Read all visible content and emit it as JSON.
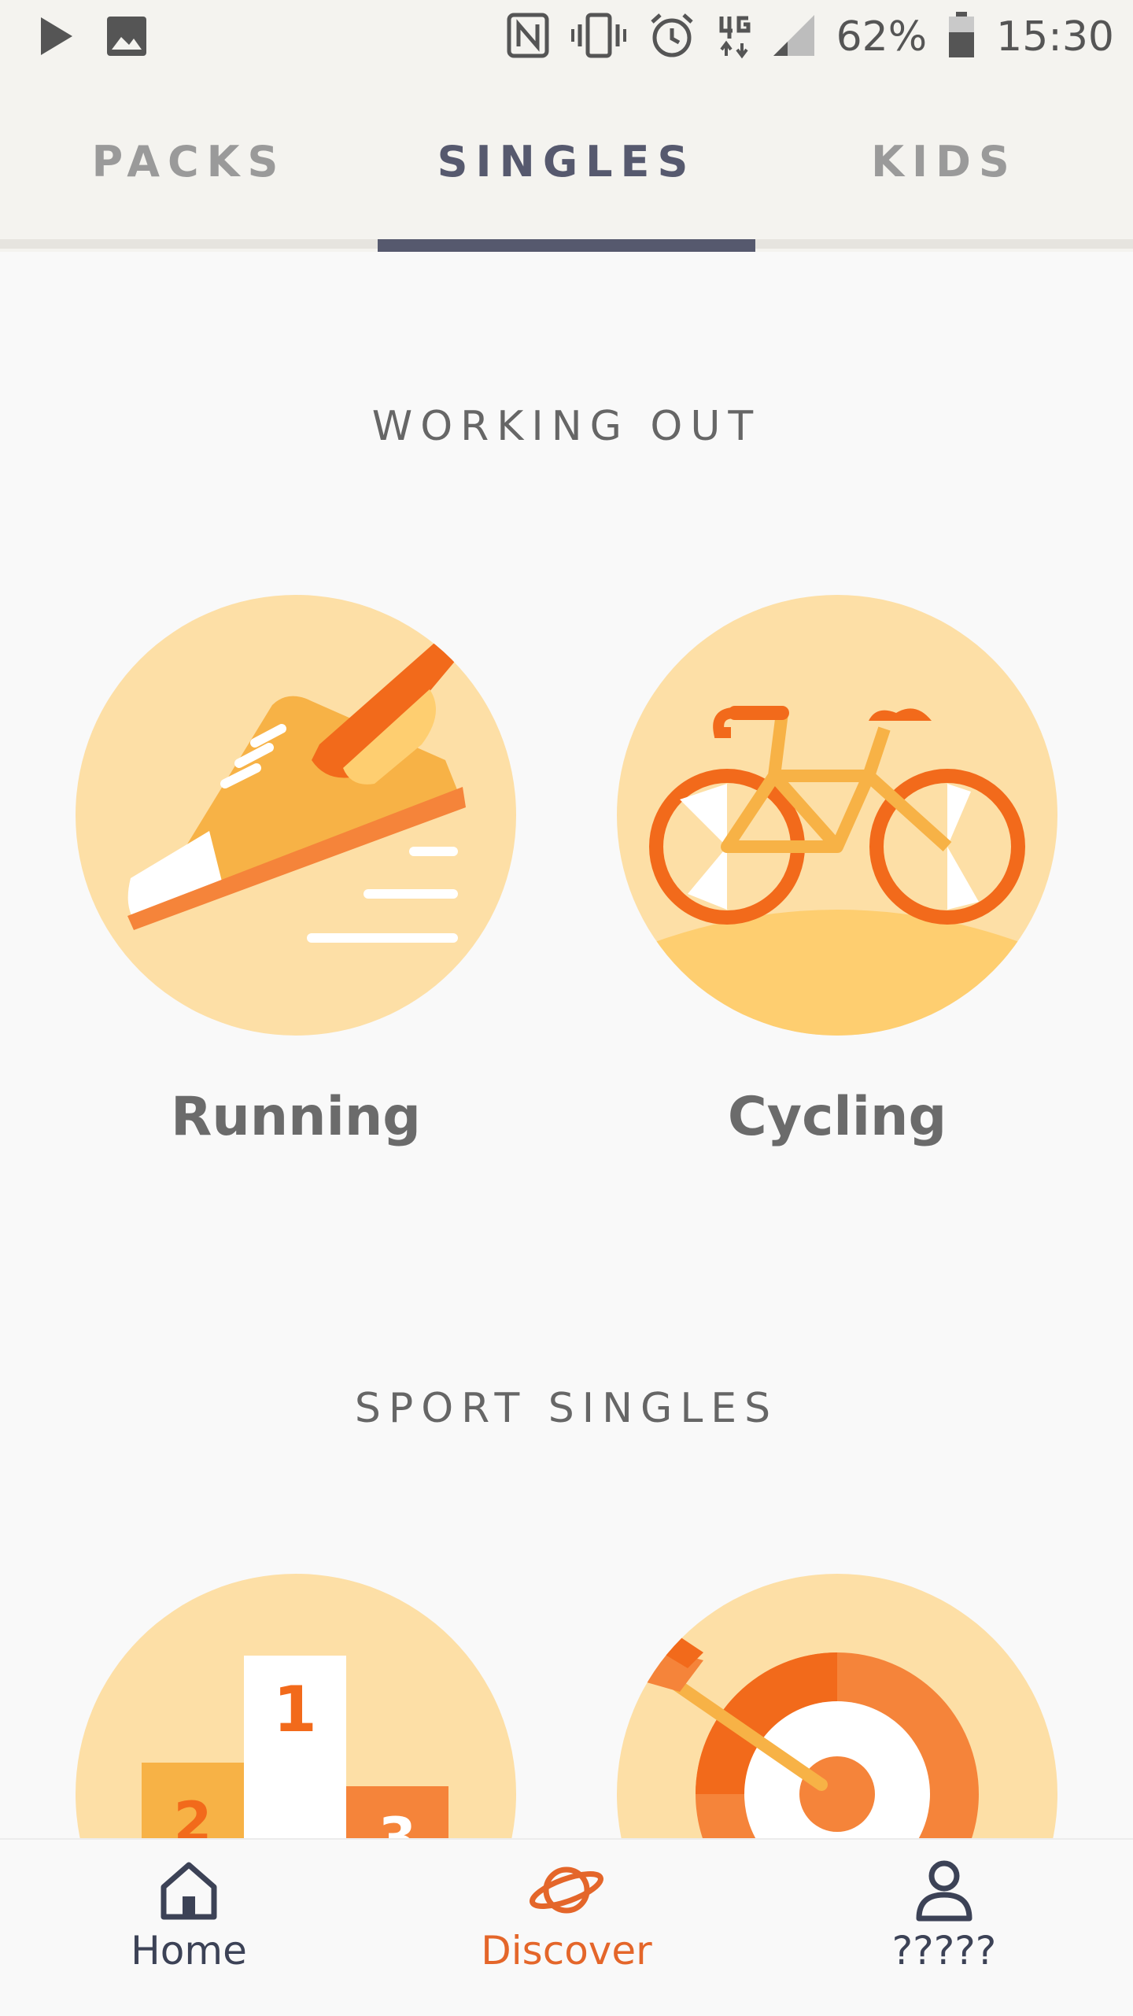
{
  "status_bar": {
    "battery": "62%",
    "time": "15:30"
  },
  "tabs": [
    {
      "label": "PACKS"
    },
    {
      "label": "SINGLES"
    },
    {
      "label": "KIDS"
    }
  ],
  "sections": [
    {
      "title": "WORKING OUT",
      "items": [
        {
          "label": "Running"
        },
        {
          "label": "Cycling"
        }
      ]
    },
    {
      "title": "SPORT SINGLES"
    }
  ],
  "bottom_nav": [
    {
      "label": "Home",
      "icon": "home-icon"
    },
    {
      "label": "Discover",
      "icon": "planet-icon"
    },
    {
      "label": "?????",
      "icon": "profile-icon"
    }
  ],
  "colors": {
    "accent": "#E4662A",
    "tab_active": "#56596E",
    "tile_bg": "#FDDFA6",
    "orange_dark": "#F26A1B",
    "orange": "#F5843A",
    "orange_light": "#F7B246"
  }
}
